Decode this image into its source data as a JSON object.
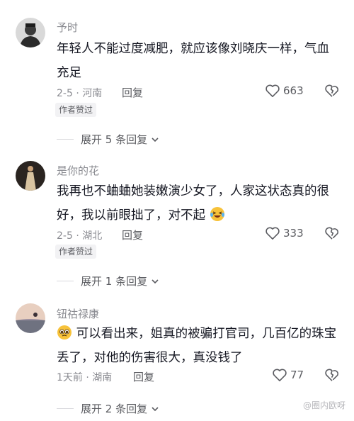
{
  "comments": [
    {
      "username": "予时",
      "content": "年轻人不能过度减肥，就应该像刘晓庆一样，气血充足",
      "meta": "2-5 · 河南",
      "reply": "回复",
      "likes": "663",
      "badge": "作者赞过",
      "expand": "展开 5 条回复",
      "avatar_icon": "man-portrait-avatar"
    },
    {
      "username": "是你的花",
      "content": "我再也不蛐蛐她装嫩演少女了，人家这状态真的很好，我以前眼拙了，对不起",
      "content_emoji": "laughing-crying-emoji",
      "meta": "2-5 · 湖北",
      "reply": "回复",
      "likes": "333",
      "badge": "作者赞过",
      "expand": "展开 1 条回复",
      "avatar_icon": "woman-in-dress-avatar"
    },
    {
      "username": "钮祜禄康",
      "content": "可以看出来，姐真的被骗打官司，几百亿的珠宝丢了，对他的伤害很大，真没钱了",
      "content_emoji": "pleading-face-emoji",
      "meta": "1天前 · 湖南",
      "reply": "回复",
      "likes": "77",
      "expand": "展开 2 条回复",
      "avatar_icon": "sunset-lake-avatar"
    }
  ],
  "watermark": "@圈内欧呀"
}
